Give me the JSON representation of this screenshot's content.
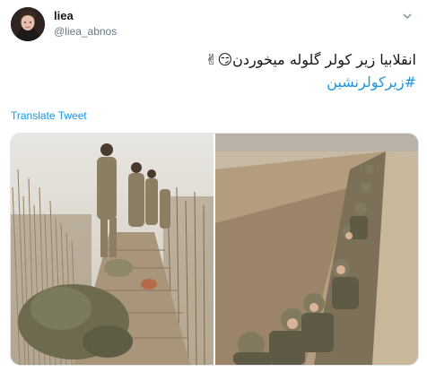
{
  "user": {
    "display_name": "liea",
    "handle": "@liea_abnos"
  },
  "tweet": {
    "line1_text": "انقلابیا زیر کولر گلوله میخوردن",
    "line1_emojis": "😏✌",
    "hashtag": "#زیرکولرنشین",
    "translate_label": "Translate Tweet"
  },
  "icons": {
    "menu": "chevron-down-icon"
  },
  "colors": {
    "accent": "#1b95e0",
    "text": "#14171a",
    "muted": "#657786"
  }
}
